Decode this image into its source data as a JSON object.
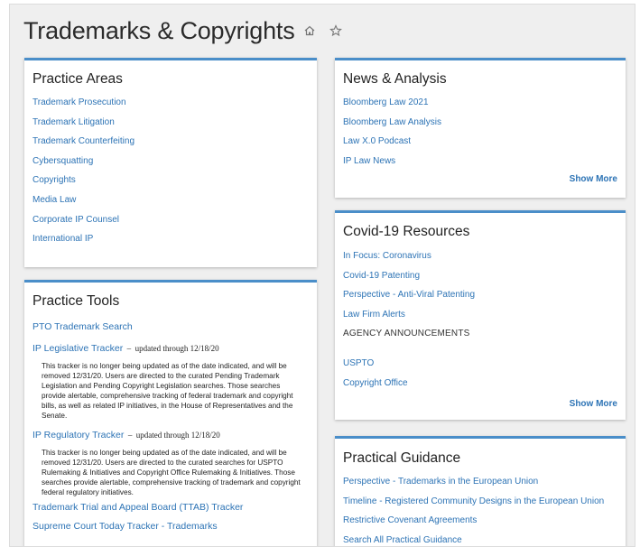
{
  "page": {
    "title": "Trademarks & Copyrights",
    "icons": [
      "home-icon",
      "star-icon"
    ]
  },
  "practice_areas": {
    "heading": "Practice Areas",
    "items": [
      "Trademark Prosecution",
      "Trademark Litigation",
      "Trademark Counterfeiting",
      "Cybersquatting",
      "Copyrights",
      "Media Law",
      "Corporate IP Counsel",
      "International IP"
    ]
  },
  "news": {
    "heading": "News & Analysis",
    "items": [
      "Bloomberg Law 2021",
      "Bloomberg Law Analysis",
      "Law X.0 Podcast",
      "IP Law News"
    ],
    "show_more": "Show More"
  },
  "covid": {
    "heading": "Covid-19 Resources",
    "items": [
      "In Focus: Coronavirus",
      "Covid-19 Patenting",
      "Perspective - Anti-Viral Patenting",
      "Law Firm Alerts"
    ],
    "agency_heading": "AGENCY ANNOUNCEMENTS",
    "agency_items": [
      "USPTO",
      "Copyright Office"
    ],
    "show_more": "Show More"
  },
  "tools": {
    "heading": "Practice Tools",
    "pto": "PTO Trademark Search",
    "legislative": {
      "label": "IP Legislative Tracker",
      "dash": "–",
      "updated": "updated through 12/18/20",
      "description": "This tracker is no longer being updated as of the date indicated, and will be removed 12/31/20. Users are directed to the curated Pending Trademark Legislation and Pending Copyright Legislation searches. Those searches provide alertable, comprehensive tracking of federal trademark and copyright bills, as well as related IP initiatives, in the House of Representatives and the Senate."
    },
    "regulatory": {
      "label": "IP Regulatory Tracker",
      "dash": "–",
      "updated": "updated through 12/18/20",
      "description": "This tracker is no longer being updated as of the date indicated, and will be removed 12/31/20. Users are directed to the curated searches for USPTO Rulemaking & Initiatives and Copyright Office Rulemaking & Initiatives. Those searches provide alertable, comprehensive tracking of trademark and copyright federal regulatory initiatives."
    },
    "ttab": "Trademark Trial and Appeal Board (TTAB) Tracker",
    "supreme": "Supreme Court Today Tracker - Trademarks"
  },
  "guidance": {
    "heading": "Practical Guidance",
    "items": [
      "Perspective - Trademarks in the European Union",
      "Timeline - Registered Community Designs in the European Union",
      "Restrictive Covenant Agreements",
      "Search All Practical Guidance"
    ]
  }
}
